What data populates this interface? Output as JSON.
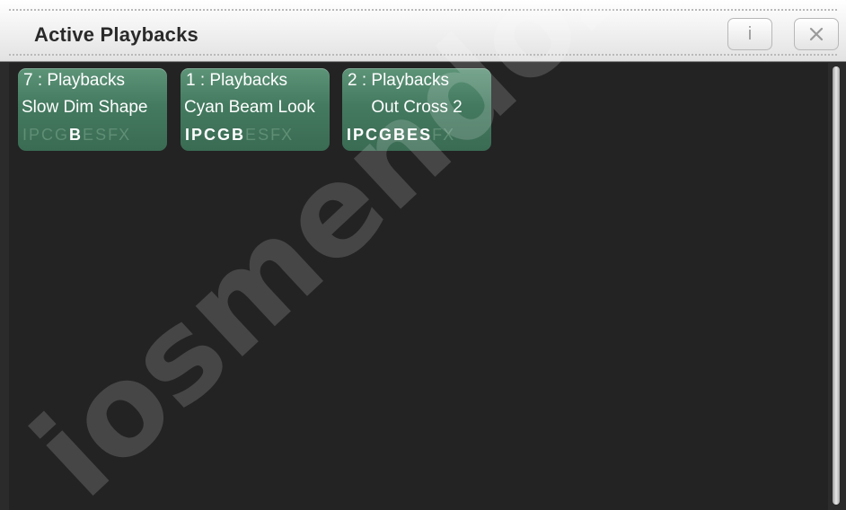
{
  "window": {
    "title": "Active Playbacks",
    "info_button_label": "i",
    "close_icon": "close-icon"
  },
  "playbacks": [
    {
      "header": "7 : Playbacks",
      "name": "Slow Dim Shape",
      "flags": [
        {
          "label": "I",
          "active": false
        },
        {
          "label": "P",
          "active": false
        },
        {
          "label": "C",
          "active": false
        },
        {
          "label": "G",
          "active": false
        },
        {
          "label": "B",
          "active": true
        },
        {
          "label": "E",
          "active": false
        },
        {
          "label": "S",
          "active": false
        },
        {
          "label": "FX",
          "active": false
        }
      ]
    },
    {
      "header": "1 : Playbacks",
      "name": "Cyan Beam Look",
      "flags": [
        {
          "label": "I",
          "active": true
        },
        {
          "label": "P",
          "active": true
        },
        {
          "label": "C",
          "active": true
        },
        {
          "label": "G",
          "active": true
        },
        {
          "label": "B",
          "active": true
        },
        {
          "label": "E",
          "active": false
        },
        {
          "label": "S",
          "active": false
        },
        {
          "label": "FX",
          "active": false
        }
      ]
    },
    {
      "header": "2 : Playbacks",
      "name": "Out Cross 2",
      "flags": [
        {
          "label": "I",
          "active": true
        },
        {
          "label": "P",
          "active": true
        },
        {
          "label": "C",
          "active": true
        },
        {
          "label": "G",
          "active": true
        },
        {
          "label": "B",
          "active": true
        },
        {
          "label": "E",
          "active": true
        },
        {
          "label": "S",
          "active": true
        },
        {
          "label": "FX",
          "active": false
        }
      ]
    }
  ],
  "watermark": "iosmendoza",
  "colors": {
    "tile": "#447a60",
    "flag_active": "#ffffff",
    "flag_inactive": "#5f8f75",
    "background": "#232323"
  }
}
